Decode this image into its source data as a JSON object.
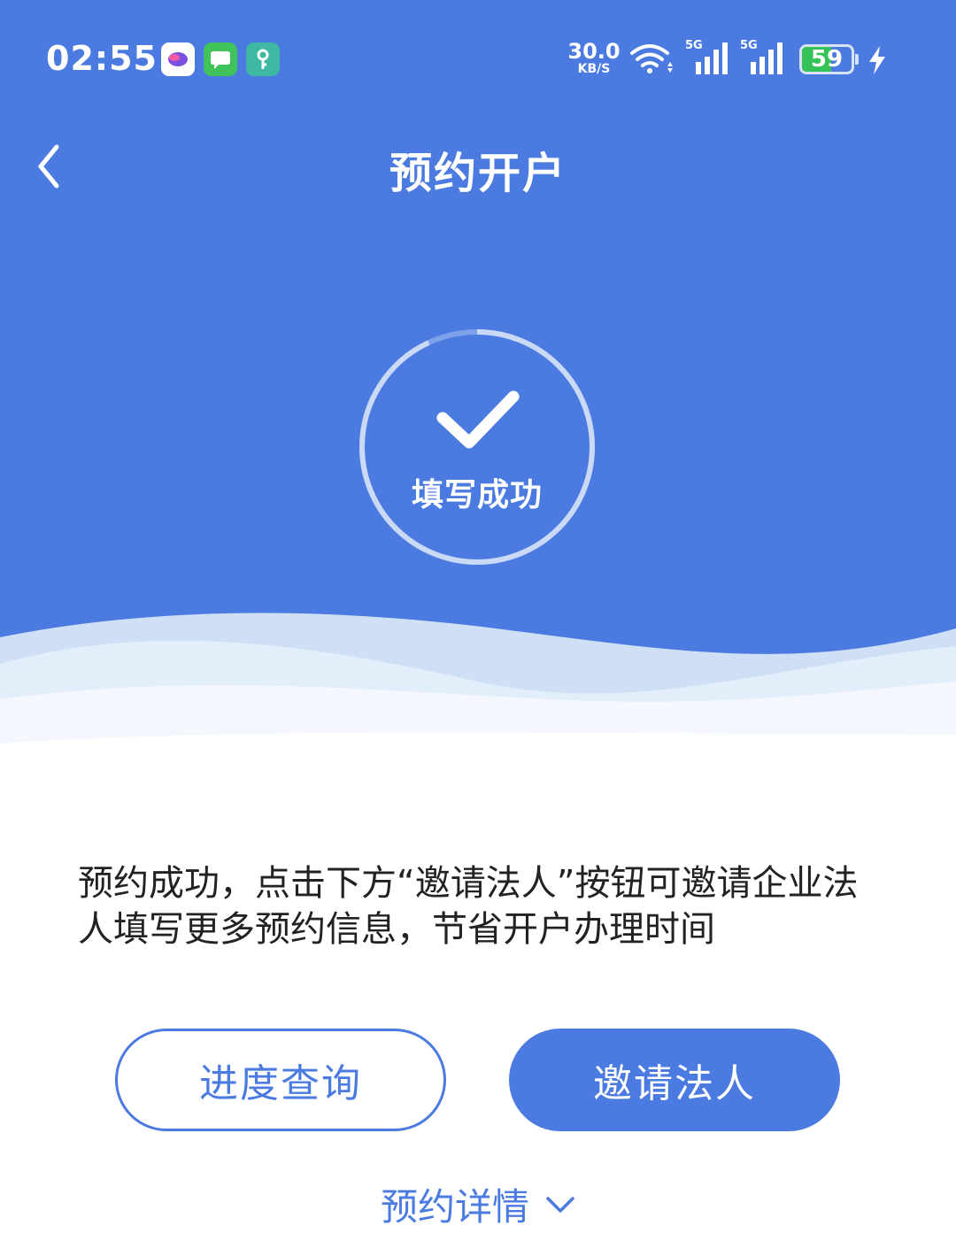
{
  "status_bar": {
    "time": "02:55",
    "net_speed_value": "30.0",
    "net_speed_unit": "KB/S",
    "signal_1_label": "5G",
    "signal_2_label": "5G",
    "battery_level": "59",
    "battery_percent": 59,
    "icons": [
      "chat-app-icon",
      "message-app-icon",
      "key-app-icon",
      "wifi-icon",
      "cellular-signal-icon",
      "battery-icon",
      "charging-bolt-icon"
    ]
  },
  "nav": {
    "title": "预约开户",
    "back_icon": "chevron-left-icon"
  },
  "success": {
    "label": "填写成功",
    "icon": "check-icon"
  },
  "message": "预约成功，点击下方“邀请法人”按钮可邀请企业法人填写更多预约信息，节省开户办理时间",
  "buttons": {
    "progress_query": "进度查询",
    "invite_legal_person": "邀请法人"
  },
  "details": {
    "label": "预约详情",
    "icon": "chevron-down-icon"
  },
  "colors": {
    "primary": "#4b7be0",
    "battery": "#35c256",
    "text": "#222222"
  }
}
